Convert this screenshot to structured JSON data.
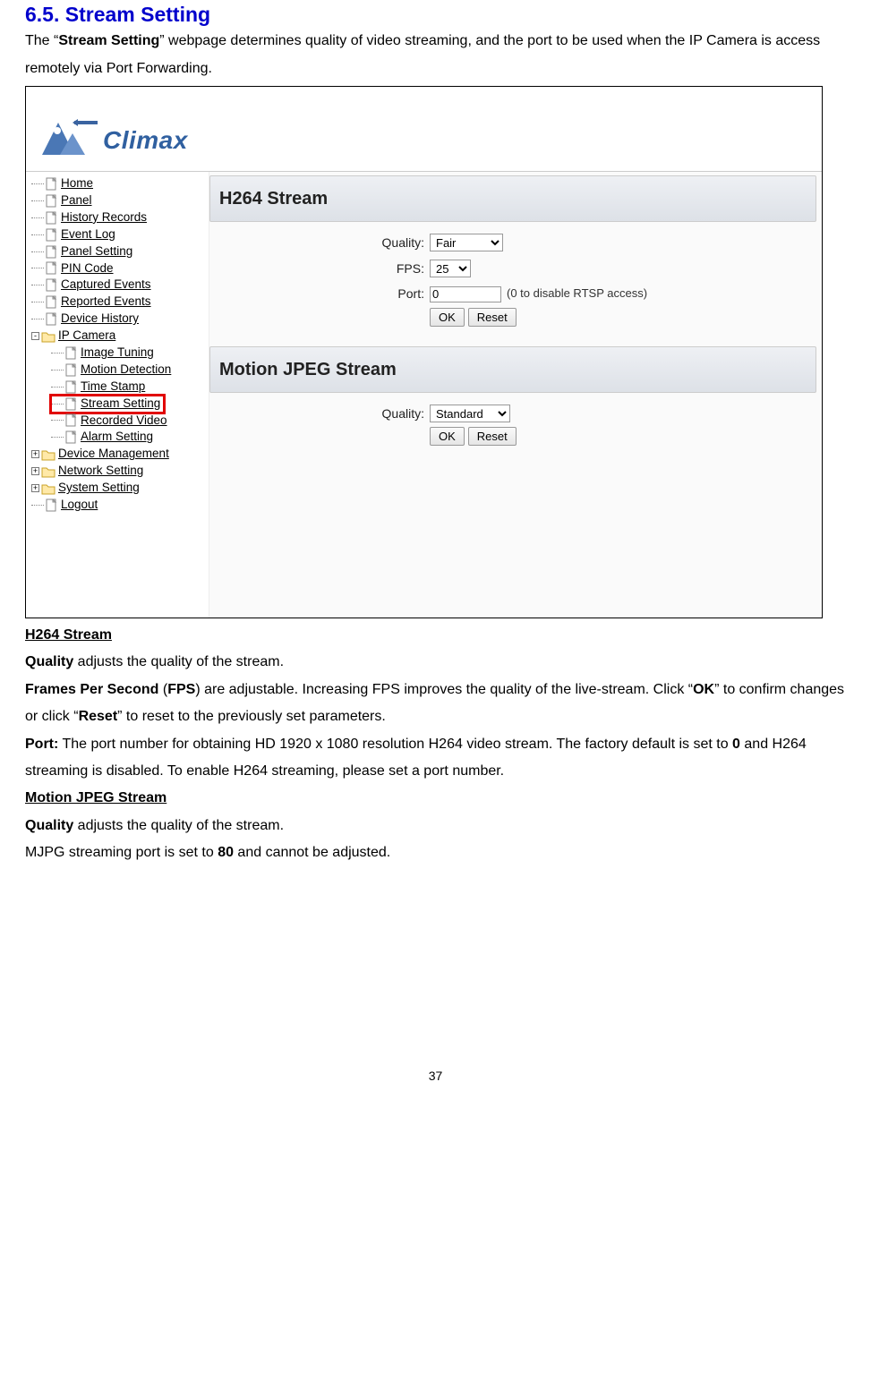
{
  "heading": "6.5. Stream Setting",
  "intro_pre": "The “",
  "intro_bold": "Stream Setting",
  "intro_post": "” webpage determines quality of video streaming, and the port to be used when the IP Camera is access remotely via Port Forwarding.",
  "logo_text": "Climax",
  "tree": {
    "items": [
      {
        "label": "Home"
      },
      {
        "label": "Panel"
      },
      {
        "label": "History Records"
      },
      {
        "label": "Event Log"
      },
      {
        "label": "Panel Setting"
      },
      {
        "label": "PIN Code"
      },
      {
        "label": "Captured Events"
      },
      {
        "label": "Reported Events"
      },
      {
        "label": "Device History"
      }
    ],
    "ipcam_label": "IP Camera",
    "ipcam_children": [
      {
        "label": "Image Tuning"
      },
      {
        "label": "Motion Detection"
      },
      {
        "label": "Time Stamp"
      },
      {
        "label": "Stream Setting",
        "highlight": true
      },
      {
        "label": "Recorded Video"
      },
      {
        "label": "Alarm Setting"
      }
    ],
    "folders": [
      {
        "label": "Device Management"
      },
      {
        "label": "Network Setting"
      },
      {
        "label": "System Setting"
      }
    ],
    "logout": "Logout"
  },
  "h264": {
    "header": "H264 Stream",
    "quality_label": "Quality:",
    "quality_value": "Fair",
    "fps_label": "FPS:",
    "fps_value": "25",
    "port_label": "Port:",
    "port_value": "0",
    "port_hint": "(0 to disable RTSP access)",
    "ok": "OK",
    "reset": "Reset"
  },
  "mjpeg": {
    "header": "Motion JPEG Stream",
    "quality_label": "Quality:",
    "quality_value": "Standard",
    "ok": "OK",
    "reset": "Reset"
  },
  "below": {
    "h264_title": "H264 Stream",
    "q_bold": "Quality",
    "q_rest": " adjusts the quality of the stream.",
    "fps_b1": "Frames Per Second",
    "fps_paren_pre": " (",
    "fps_b2": "FPS",
    "fps_paren_post": ") are adjustable. Increasing FPS improves the quality of the live-stream. Click “",
    "ok_b": "OK",
    "fps_mid": "” to confirm changes or click “",
    "reset_b": "Reset",
    "fps_end": "” to reset to the previously set parameters.",
    "port_b": "Port:",
    "port_rest1": " The port number for obtaining HD 1920 x 1080 resolution H264 video stream. The factory default is set to ",
    "port_zero": "0",
    "port_rest2": " and H264 streaming is disabled. To enable H264 streaming, please set a port number.",
    "mj_title": "Motion JPEG Stream",
    "mj_q_b": "Quality",
    "mj_q_rest": " adjusts the quality of the stream.",
    "mj_port_pre": "MJPG streaming port is set to ",
    "mj_port_b": "80",
    "mj_port_post": " and cannot be adjusted."
  },
  "page_num": "37"
}
